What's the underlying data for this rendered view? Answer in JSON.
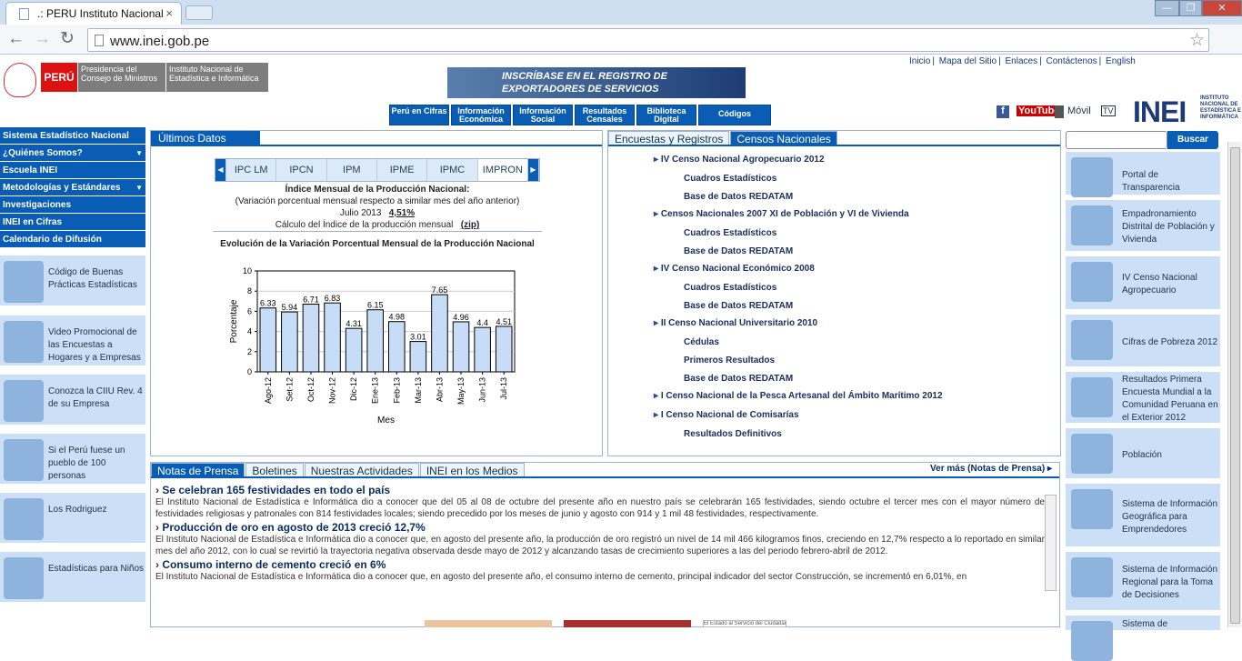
{
  "browser": {
    "tab_title": ".: PERU Instituto Nacional",
    "tab_close": "×",
    "url": "www.inei.gob.pe",
    "window_controls": [
      "—",
      "❐",
      "✕"
    ]
  },
  "header": {
    "peru": "PERÚ",
    "gob1": "Presidencia del Consejo de Ministros",
    "gob2": "Instituto Nacional de Estadística e Informática",
    "banner": "INSCRÍBASE EN EL REGISTRO DE EXPORTADORES DE SERVICIOS",
    "toplinks": [
      "Inicio",
      "Mapa del Sitio",
      "Enlaces",
      "Contáctenos",
      "English"
    ],
    "social": {
      "youtube": "YouTube",
      "movil": "Móvil",
      "tv": "TV"
    },
    "logo": "INEI",
    "logo_sub": "INSTITUTO NACIONAL DE ESTADÍSTICA E INFORMÁTICA",
    "nav": [
      "Perú en Cifras",
      "Información Económica",
      "Información Social",
      "Resultados Censales",
      "Biblioteca Digital",
      "Códigos"
    ]
  },
  "leftnav": [
    {
      "label": "Sistema Estadístico Nacional",
      "arrow": ""
    },
    {
      "label": "¿Quiénes Somos?",
      "arrow": "▼"
    },
    {
      "label": "Escuela INEI",
      "arrow": ""
    },
    {
      "label": "Metodologías y Estándares",
      "arrow": "▼"
    },
    {
      "label": "Investigaciones",
      "arrow": ""
    },
    {
      "label": "INEI en Cifras",
      "arrow": ""
    },
    {
      "label": "Calendario de Difusión",
      "arrow": ""
    }
  ],
  "leftboxes": [
    "Código de Buenas Prácticas Estadísticas",
    "Video Promocional de las Encuestas a Hogares y a Empresas",
    "Conozca la CIIU Rev. 4 de su Empresa",
    "Si el Perú fuese un pueblo de 100 personas",
    "Los Rodriguez",
    "Estadísticas para Niños"
  ],
  "ultimos": {
    "title": "Últimos Datos",
    "tabs": [
      "IPC LM",
      "IPCN",
      "IPM",
      "IPME",
      "IPMC",
      "IMPRON"
    ],
    "indice_title": "Índice Mensual de la Producción Nacional:",
    "indice_sub": "(Variación porcentual mensual respecto a similar mes del año anterior)",
    "period": "Julio 2013",
    "value": "4,51%",
    "calc": "Cálculo del Índice de la producción mensual",
    "zip": "(zip)"
  },
  "chart_data": {
    "type": "bar",
    "title": "Evolución de la Variación Porcentual Mensual de la Producción Nacional",
    "xlabel": "Mes",
    "ylabel": "Porcentaje",
    "ylim": [
      0,
      10
    ],
    "yticks": [
      "0",
      "2",
      "4",
      "6",
      "8",
      "10"
    ],
    "categories": [
      "Ago-12",
      "Set-12",
      "Oct-12",
      "Nov-12",
      "Dic-12",
      "Ene-13",
      "Feb-13",
      "Mar-13",
      "Abr-13",
      "May-13",
      "Jun-13",
      "Jul-13"
    ],
    "values": [
      6.33,
      5.94,
      6.71,
      6.83,
      4.31,
      6.15,
      4.98,
      3.01,
      7.65,
      4.96,
      4.4,
      4.51
    ],
    "labels": [
      "6.33",
      "5.94",
      "6.71",
      "6.83",
      "4.31",
      "6.15",
      "4.98",
      "3.01",
      "7.65",
      "4.96",
      "4.4",
      "4.51"
    ],
    "colors": {
      "bar": "#c6dcf7",
      "stroke": "#000"
    }
  },
  "censos": {
    "tabs": [
      "Encuestas y Registros",
      "Censos Nacionales"
    ],
    "items": [
      {
        "t": "IV Censo Nacional Agropecuario 2012",
        "l": 1
      },
      {
        "t": "Cuadros Estadísticos",
        "l": 2
      },
      {
        "t": "Base de Datos REDATAM",
        "l": 2
      },
      {
        "t": "Censos Nacionales 2007 XI de Población y VI de Vivienda",
        "l": 1
      },
      {
        "t": "Cuadros Estadísticos",
        "l": 2
      },
      {
        "t": "Base de Datos REDATAM",
        "l": 2
      },
      {
        "t": "IV Censo Nacional Económico 2008",
        "l": 1
      },
      {
        "t": "Cuadros Estadísticos",
        "l": 2
      },
      {
        "t": "Base de Datos REDATAM",
        "l": 2
      },
      {
        "t": "II Censo Nacional Universitario 2010",
        "l": 1
      },
      {
        "t": "Cédulas",
        "l": 2
      },
      {
        "t": "Primeros Resultados",
        "l": 2
      },
      {
        "t": "Base de Datos REDATAM",
        "l": 2
      },
      {
        "t": "I Censo Nacional de la Pesca Artesanal del  Ámbito Marítimo 2012",
        "l": 1
      },
      {
        "t": "I Censo Nacional de Comisarías",
        "l": 1
      },
      {
        "t": "Resultados Definitivos",
        "l": 2
      }
    ]
  },
  "notas": {
    "tabs": [
      "Notas de Prensa",
      "Boletines",
      "Nuestras Actividades",
      "INEI en los Medios"
    ],
    "more": "Ver más (Notas de Prensa) ▸",
    "items": [
      {
        "h": "Se celebran 165 festividades en todo el país",
        "b": "El Instituto Nacional de Estadística e Informática dio a conocer que del 05 al 08 de octubre del presente año en nuestro país se celebrarán 165 festividades, siendo octubre el tercer mes con el mayor número de festividades religiosas y patronales con 814 festividades locales; siendo precedido por los meses de junio y agosto con 914 y 1 mil 48 festividades, respectivamente."
      },
      {
        "h": "Producción de oro en agosto de 2013 creció 12,7%",
        "b": "El Instituto Nacional de Estadística e Informática dio a conocer que, en agosto del presente año, la producción de oro registró un nivel de 14 mil 466 kilogramos finos, creciendo en 12,7% respecto a lo reportado en similar mes del año 2012, con lo cual se revirtió la trayectoria negativa observada desde mayo de 2012 y alcanzando tasas de crecimiento superiores a las del periodo febrero-abril de 2012."
      },
      {
        "h": "Consumo interno de cemento creció en 6%",
        "b": "El Instituto Nacional de Estadística e Informática dio a conocer que, en agosto del presente año, el consumo interno de cemento, principal indicador del sector Construcción, se incrementó en 6,01%, en"
      }
    ]
  },
  "search": {
    "button": "Buscar",
    "value": ""
  },
  "rightboxes": [
    "Portal de Transparencia",
    "Empadronamiento Distrital de Población y Vivienda",
    "IV Censo Nacional Agropecuario",
    "Cifras de Pobreza 2012",
    "Resultados Primera Encuesta Mundial a la Comunidad Peruana en el Exterior 2012",
    "Población",
    "Sistema de Información Geográfica para Emprendedores",
    "Sistema de Información Regional para la Toma de Decisiones",
    "Sistema de"
  ],
  "footer_text": "El Estado al Servicio del Ciudadano"
}
